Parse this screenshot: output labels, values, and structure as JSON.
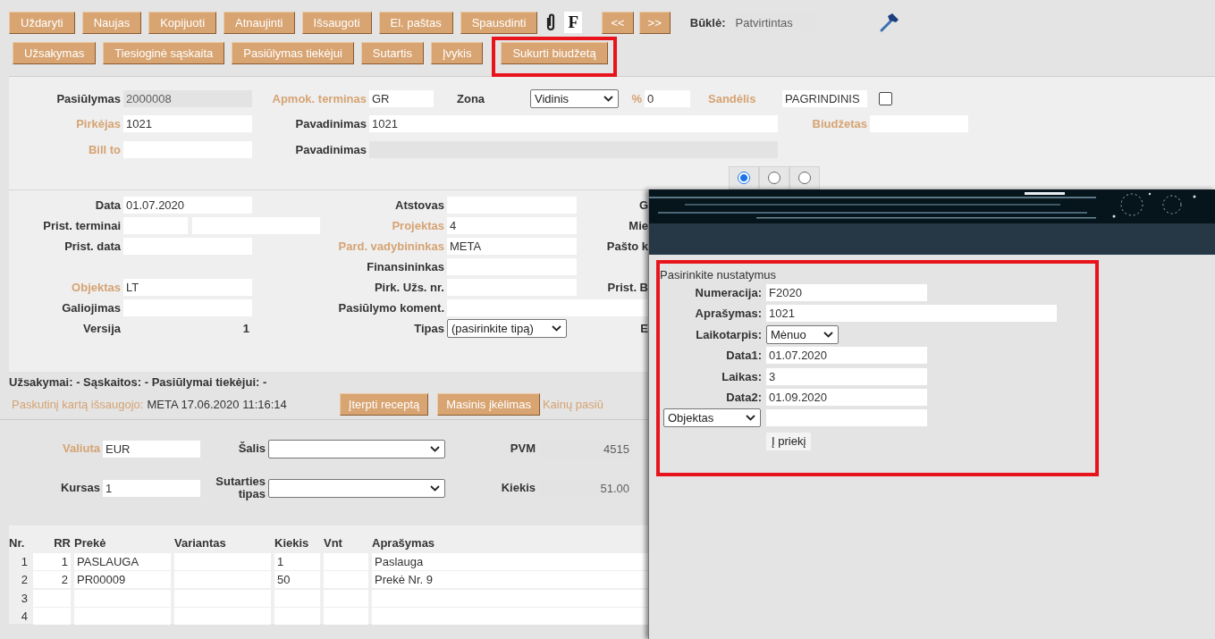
{
  "toolbar": {
    "buttons": [
      "Uždaryti",
      "Naujas",
      "Kopijuoti",
      "Atnaujinti",
      "Išsaugoti",
      "El. paštas",
      "Spausdinti"
    ],
    "letter_button": "F",
    "nav_buttons": [
      "<<",
      ">>"
    ],
    "status_label": "Būklė:",
    "status_value": "Patvirtintas"
  },
  "toolbar_2": {
    "buttons": [
      {
        "label": "Užsakymas",
        "highlighted": false
      },
      {
        "label": "Tiesioginė sąskaita",
        "highlighted": false
      },
      {
        "label": "Pasiūlymas tiekėjui",
        "highlighted": false
      },
      {
        "label": "Sutartis",
        "highlighted": false
      },
      {
        "label": "Įvykis",
        "highlighted": false
      },
      {
        "label": "Sukurti biudžetą",
        "highlighted": true
      }
    ]
  },
  "header": {
    "rows": [
      {
        "left": {
          "label": "Pasiūlymas",
          "value": "2000008",
          "kind": "readonly",
          "linked": false
        },
        "middle": {
          "label": "Apmok. terminas",
          "value": "GR",
          "kind": "text",
          "linked": true
        },
        "zone": {
          "label": "Zona",
          "value": "Vidinis",
          "kind": "select",
          "linked": false
        },
        "percent": {
          "label": "%",
          "value": "0",
          "kind": "text",
          "linked": true
        },
        "warehouse": {
          "label": "Sandėlis",
          "value": "PAGRINDINIS",
          "kind": "text",
          "linked": true,
          "checkbox": {
            "checked": false
          }
        }
      },
      {
        "left": {
          "label": "Pirkėjas",
          "value": "1021",
          "kind": "text",
          "linked": true
        },
        "middle": {
          "label": "Pavadinimas",
          "value": "1021",
          "kind": "text",
          "linked": false
        },
        "budget": {
          "label": "Biudžetas",
          "kind": "text",
          "linked": true
        }
      },
      {
        "left": {
          "label": "Bill to",
          "kind": "text",
          "linked": true
        },
        "middle": {
          "label": "Pavadinimas",
          "kind": "readonly",
          "linked": false
        }
      }
    ]
  },
  "view_switch": [
    {
      "selected": true
    },
    {
      "selected": false
    },
    {
      "selected": false
    }
  ],
  "details": {
    "rows": [
      {
        "left": {
          "label": "Data",
          "value": "01.07.2020",
          "kind": "text",
          "linked": false
        },
        "middle": {
          "label": "Atstovas",
          "kind": "text",
          "linked": false
        },
        "right": {
          "label": "G",
          "kind": "label",
          "linked": false
        }
      },
      {
        "left": {
          "label": "Prist. terminai",
          "kind": "split",
          "linked": false
        },
        "middle": {
          "label": "Projektas",
          "value": "4",
          "kind": "text",
          "linked": true
        },
        "right": {
          "label": "Mie",
          "kind": "label",
          "linked": false
        }
      },
      {
        "left": {
          "label": "Prist. data",
          "kind": "text",
          "linked": false
        },
        "middle": {
          "label": "Pard. vadybininkas",
          "value": "META",
          "kind": "text",
          "linked": true
        },
        "right": {
          "label": "Pašto k",
          "kind": "label",
          "linked": false
        }
      },
      {
        "middle": {
          "label": "Finansininkas",
          "kind": "text",
          "linked": false
        }
      },
      {
        "left": {
          "label": "Objektas",
          "value": "LT",
          "kind": "text",
          "linked": true
        },
        "middle": {
          "label": "Pirk. Užs. nr.",
          "kind": "text",
          "linked": false
        },
        "right": {
          "label": "Prist. B",
          "kind": "label",
          "linked": false
        }
      },
      {
        "left": {
          "label": "Galiojimas",
          "kind": "text",
          "linked": false
        },
        "middle": {
          "label": "Pasiūlymo koment.",
          "kind": "wide",
          "linked": false
        }
      },
      {
        "left": {
          "label": "Versija",
          "value": "1",
          "kind": "static",
          "linked": false
        },
        "middle": {
          "label": "Tipas",
          "value": "(pasirinkite tipą)",
          "kind": "select",
          "linked": false
        },
        "right": {
          "label": "E",
          "kind": "label",
          "linked": false
        }
      }
    ]
  },
  "links_summary": "Užsakymai: - Sąskaitos: - Pasiūlymai tiekėjui: -",
  "last_saved": {
    "label": "Paskutinį kartą išsaugojo:",
    "value": "META 17.06.2020 11:16:14"
  },
  "action_buttons": [
    "Įterpti receptą",
    "Masinis įkėlimas"
  ],
  "cut_link": "Kainų pasiū",
  "totals": {
    "rows": [
      [
        {
          "label": "Valiuta",
          "value": "EUR",
          "kind": "text",
          "linked": true
        },
        {
          "label": "Šalis",
          "kind": "select",
          "linked": false
        },
        {
          "label": "PVM",
          "value": "4515",
          "kind": "readonly",
          "linked": false
        }
      ],
      [
        {
          "label": "Kursas",
          "value": "1",
          "kind": "text",
          "linked": false
        },
        {
          "label": "Sutarties tipas",
          "kind": "select",
          "linked": false
        },
        {
          "label": "Kiekis",
          "value": "51.00",
          "kind": "readonly",
          "linked": false
        }
      ]
    ]
  },
  "items_table": {
    "columns": [
      "Nr.",
      "RR",
      "Prekė",
      "Variantas",
      "Kiekis",
      "Vnt",
      "Aprašymas"
    ],
    "rows": [
      {
        "nr": "1",
        "rr": "1",
        "product": "PASLAUGA",
        "quantity": "1",
        "description": "Paslauga"
      },
      {
        "nr": "2",
        "rr": "2",
        "product": "PR00009",
        "quantity": "50",
        "description": "Prekė Nr. 9"
      },
      {
        "nr": "3"
      },
      {
        "nr": "4"
      }
    ]
  },
  "dialog": {
    "title": "Pasirinkite nustatymus",
    "highlighted": true,
    "fields": [
      {
        "label": "Numeracija:",
        "value": "F2020",
        "kind": "text"
      },
      {
        "label": "Aprašymas:",
        "value": "1021",
        "kind": "wide"
      },
      {
        "label": "Laikotarpis:",
        "value": "Mėnuo",
        "kind": "select"
      },
      {
        "label": "Data1:",
        "value": "01.07.2020",
        "kind": "text"
      },
      {
        "label": "Laikas:",
        "value": "3",
        "kind": "text"
      },
      {
        "label": "Data2:",
        "value": "01.09.2020",
        "kind": "text"
      },
      {
        "label": "Objektas",
        "kind": "picker"
      }
    ],
    "button": "Į priekį"
  }
}
